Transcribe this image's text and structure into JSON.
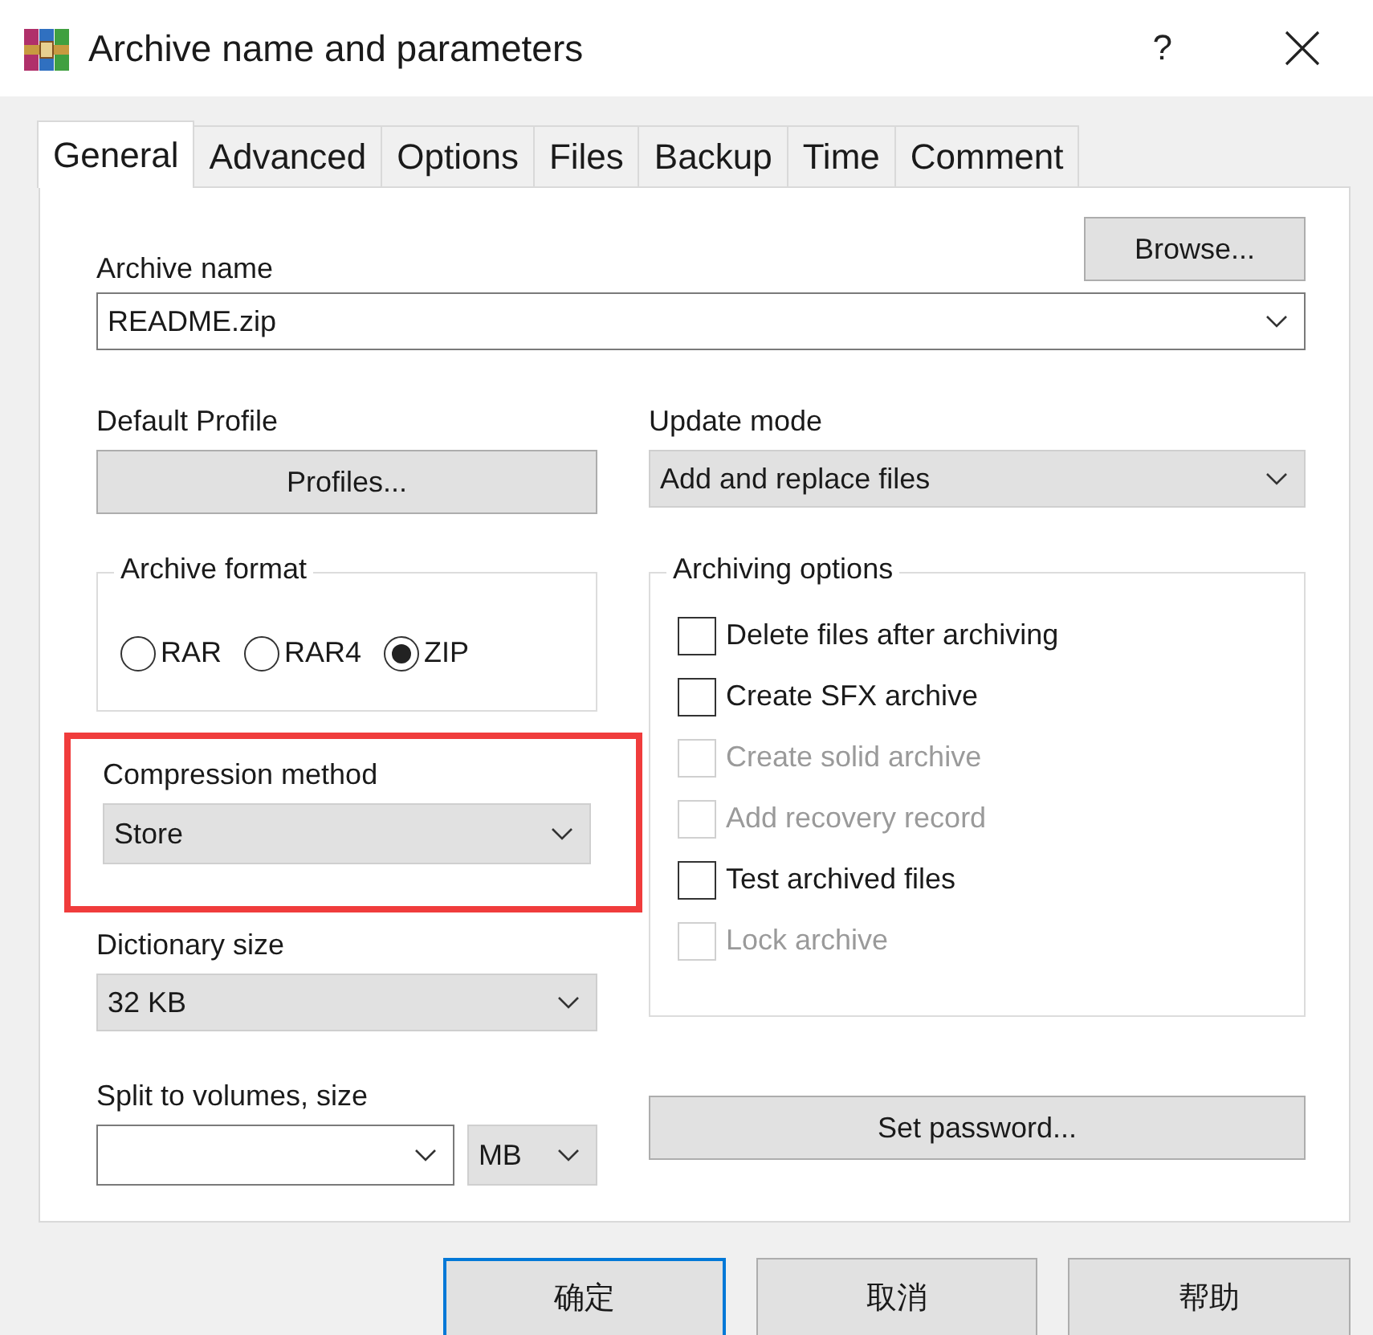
{
  "window": {
    "title": "Archive name and parameters",
    "help": "?"
  },
  "tabs": [
    {
      "label": "General",
      "selected": true
    },
    {
      "label": "Advanced",
      "selected": false
    },
    {
      "label": "Options",
      "selected": false
    },
    {
      "label": "Files",
      "selected": false
    },
    {
      "label": "Backup",
      "selected": false
    },
    {
      "label": "Time",
      "selected": false
    },
    {
      "label": "Comment",
      "selected": false
    }
  ],
  "archive_name": {
    "label": "Archive name",
    "value": "README.zip",
    "browse_button": "Browse..."
  },
  "default_profile": {
    "label": "Default Profile",
    "button": "Profiles..."
  },
  "update_mode": {
    "label": "Update mode",
    "value": "Add and replace files"
  },
  "archive_format": {
    "title": "Archive format",
    "options": [
      {
        "label": "RAR",
        "selected": false
      },
      {
        "label": "RAR4",
        "selected": false
      },
      {
        "label": "ZIP",
        "selected": true
      }
    ]
  },
  "compression_method": {
    "label": "Compression method",
    "value": "Store",
    "highlighted": true
  },
  "dictionary_size": {
    "label": "Dictionary size",
    "value": "32 KB"
  },
  "split_volumes": {
    "label": "Split to volumes, size",
    "unit": "MB"
  },
  "archiving_options": {
    "title": "Archiving options",
    "items": [
      {
        "label": "Delete files after archiving",
        "checked": false,
        "disabled": false
      },
      {
        "label": "Create SFX archive",
        "checked": false,
        "disabled": false
      },
      {
        "label": "Create solid archive",
        "checked": false,
        "disabled": true
      },
      {
        "label": "Add recovery record",
        "checked": false,
        "disabled": true
      },
      {
        "label": "Test archived files",
        "checked": false,
        "disabled": false
      },
      {
        "label": "Lock archive",
        "checked": false,
        "disabled": true
      }
    ]
  },
  "set_password_button": "Set password...",
  "buttons": [
    {
      "label": "确定",
      "focused": true
    },
    {
      "label": "取消",
      "focused": false
    },
    {
      "label": "帮助",
      "focused": false
    }
  ]
}
